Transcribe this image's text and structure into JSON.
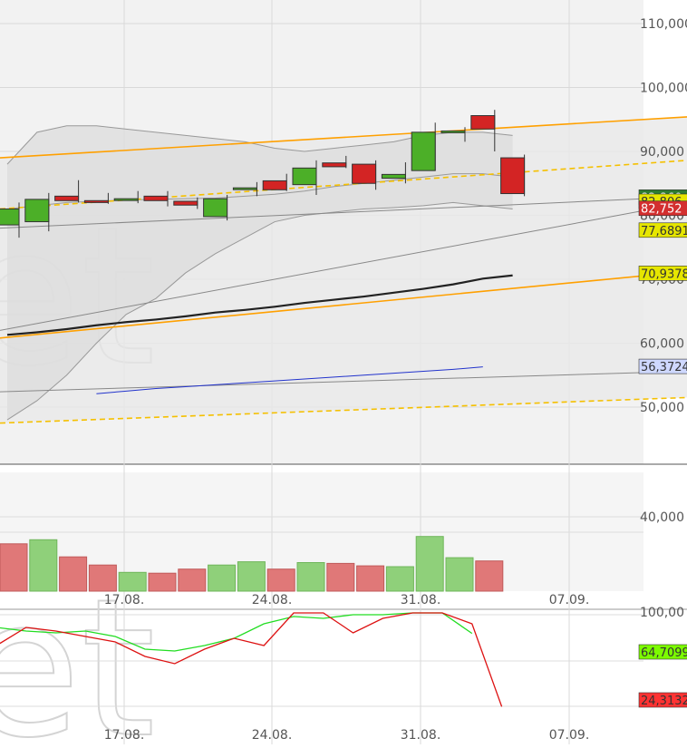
{
  "price_panel": {
    "y_ticks": [
      "110,000",
      "100,000",
      "90,000",
      "80,000",
      "70,000",
      "60,000",
      "50,000"
    ],
    "badges": [
      {
        "text": "82,860",
        "value": 82.86,
        "bg": "#2e7d32",
        "fg": "#ffffff"
      },
      {
        "text": "82,806",
        "value": 82.2,
        "bg": "#e6e600",
        "fg": "#333333"
      },
      {
        "text": "82,752",
        "value": 81.1,
        "bg": "#d32f2f",
        "fg": "#ffffff"
      },
      {
        "text": "77,6891",
        "value": 77.69,
        "bg": "#e6e600",
        "fg": "#333333"
      },
      {
        "text": "70,9378",
        "value": 70.94,
        "bg": "#e6e600",
        "fg": "#333333"
      },
      {
        "text": "56,3724",
        "value": 56.37,
        "bg": "#cfd8ff",
        "fg": "#333333"
      }
    ]
  },
  "volume_panel": {
    "y_ticks": [
      "40,000"
    ]
  },
  "oscillator_panel": {
    "y_ticks": [
      "100,00"
    ],
    "badges": [
      {
        "text": "64,7099",
        "value": 64.71,
        "bg": "#7CFC00",
        "fg": "#333333"
      },
      {
        "text": "24,3132",
        "value": 24.31,
        "bg": "#ff3333",
        "fg": "#333333"
      }
    ]
  },
  "x_ticks": [
    "17.08.",
    "24.08.",
    "31.08.",
    "07.09."
  ],
  "colors": {
    "up": "#4caf28",
    "down": "#d32424",
    "vol_up": "#8fd07a",
    "vol_down": "#e07878",
    "sma_dark": "#222222",
    "trend_orange": "#ffa000",
    "trend_dashed": "#f5c000",
    "ma_blue": "#2233cc",
    "osc_green": "#22dd22",
    "osc_red": "#dd1111"
  },
  "chart_data": [
    {
      "type": "candlestick",
      "x_labels": [
        "17.08.",
        "24.08.",
        "31.08.",
        "07.09."
      ],
      "ylim": [
        45,
        113
      ],
      "candles": [
        {
          "o": 78.5,
          "h": 82,
          "l": 76.5,
          "c": 81
        },
        {
          "o": 79.0,
          "h": 83.5,
          "l": 77.5,
          "c": 82.5
        },
        {
          "o": 83.0,
          "h": 85.5,
          "l": 82.0,
          "c": 82.3
        },
        {
          "o": 82.3,
          "h": 83.5,
          "l": 81.8,
          "c": 82.0
        },
        {
          "o": 82.6,
          "h": 83.8,
          "l": 81.9,
          "c": 82.6
        },
        {
          "o": 83.0,
          "h": 83.8,
          "l": 81.4,
          "c": 82.3
        },
        {
          "o": 82.2,
          "h": 82.8,
          "l": 81.0,
          "c": 81.6
        },
        {
          "o": 79.8,
          "h": 83.2,
          "l": 79.2,
          "c": 82.6
        },
        {
          "o": 84.2,
          "h": 85.2,
          "l": 83.0,
          "c": 84.3
        },
        {
          "o": 85.4,
          "h": 86.5,
          "l": 83.8,
          "c": 84.0
        },
        {
          "o": 84.8,
          "h": 88.6,
          "l": 83.2,
          "c": 87.4
        },
        {
          "o": 88.2,
          "h": 89.3,
          "l": 87.4,
          "c": 87.6
        },
        {
          "o": 88.0,
          "h": 88.6,
          "l": 84.0,
          "c": 85.0
        },
        {
          "o": 85.8,
          "h": 88.3,
          "l": 85.0,
          "c": 86.4
        },
        {
          "o": 87.0,
          "h": 94.5,
          "l": 87.0,
          "c": 93.0
        },
        {
          "o": 93.2,
          "h": 93.8,
          "l": 91.5,
          "c": 93.2
        },
        {
          "o": 95.6,
          "h": 96.5,
          "l": 90.0,
          "c": 93.5
        },
        {
          "o": 89.0,
          "h": 89.5,
          "l": 83.0,
          "c": 83.4
        }
      ],
      "bollinger": {
        "upper": [
          88,
          93,
          94,
          94,
          93.5,
          93,
          92.5,
          92,
          91.5,
          90.5,
          90,
          90.5,
          91,
          91.5,
          92.5,
          93,
          93,
          92.5
        ],
        "middle": [
          81,
          81.5,
          82,
          82.2,
          82.4,
          82.5,
          82.6,
          82.7,
          83,
          83.3,
          83.8,
          84.5,
          85,
          85.5,
          86,
          86.5,
          86.5,
          86
        ],
        "lower": [
          48,
          51,
          55,
          60,
          64.5,
          67,
          71,
          74,
          76.5,
          79,
          80,
          80.5,
          81,
          81.2,
          81.5,
          82,
          81.5,
          81
        ]
      },
      "sma": [
        61.3,
        61.7,
        62.2,
        62.8,
        63.3,
        63.7,
        64.2,
        64.8,
        65.2,
        65.7,
        66.3,
        66.8,
        67.3,
        67.9,
        68.5,
        69.2,
        70.1,
        70.6
      ],
      "ma_blue": [
        52.1,
        52.5,
        52.9,
        53.2,
        53.5,
        53.8,
        54.1,
        54.4,
        54.7,
        55.0,
        55.3,
        55.6,
        55.9,
        56.3
      ],
      "trend_lines": [
        {
          "style": "solid",
          "color": "orange",
          "y_start": 89.0,
          "y_end": 95.4
        },
        {
          "style": "solid",
          "color": "orange",
          "y_start": 60.8,
          "y_end": 71.2
        },
        {
          "style": "dashed",
          "color": "yellow",
          "y_start": 81.0,
          "y_end": 88.6
        },
        {
          "style": "dashed",
          "color": "yellow",
          "y_start": 47.5,
          "y_end": 51.5
        },
        {
          "style": "solid",
          "color": "grey",
          "y_start": 62.0,
          "y_end": 82.0
        },
        {
          "style": "solid",
          "color": "grey",
          "y_start": 78.0,
          "y_end": 82.9
        },
        {
          "style": "solid",
          "color": "grey",
          "y_start": 52.4,
          "y_end": 55.6
        }
      ]
    },
    {
      "type": "bar",
      "series": [
        {
          "values": [
            0.58,
            0.63,
            0.42,
            0.32,
            0.23,
            0.22,
            0.27,
            0.32,
            0.36,
            0.27,
            0.35,
            0.34,
            0.31,
            0.3,
            0.67,
            0.41,
            0.37
          ],
          "colors": [
            "down",
            "up",
            "down",
            "down",
            "up",
            "down",
            "down",
            "up",
            "up",
            "down",
            "up",
            "down",
            "down",
            "up",
            "up",
            "up",
            "down"
          ]
        }
      ]
    },
    {
      "type": "line",
      "ylim": [
        0,
        100
      ],
      "series": [
        {
          "color": "green",
          "values": [
            68,
            66,
            65,
            66,
            63,
            56,
            55,
            58,
            62,
            70,
            74,
            73,
            75,
            75,
            82,
            81,
            64.7
          ]
        },
        {
          "color": "red",
          "values": [
            58,
            68,
            66,
            63,
            60,
            52,
            48,
            56,
            62,
            58,
            90,
            84,
            65,
            73,
            78,
            86,
            70,
            24.3
          ]
        }
      ]
    }
  ]
}
